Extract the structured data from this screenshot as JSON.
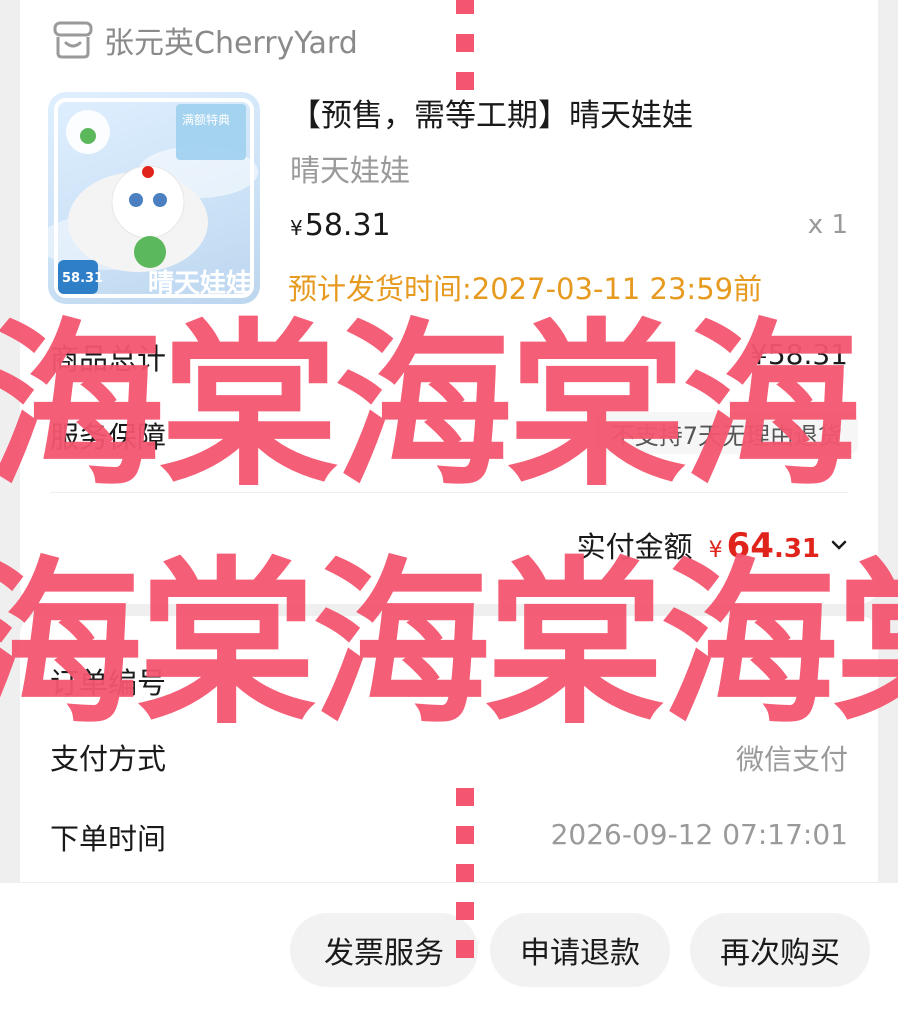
{
  "shop": {
    "name": "张元英CherryYard",
    "icon": "shop-icon"
  },
  "product": {
    "title": "【预售，需等工期】晴天娃娃",
    "subtitle": "晴天娃娃",
    "price_symbol": "¥",
    "price": "58.31",
    "quantity": "x 1",
    "ship_note": "预计发货时间:2027-03-11 23:59前",
    "image_text": {
      "badge_price": "58.31",
      "caption": "晴天娃娃",
      "corner": "满额特典"
    }
  },
  "summary": {
    "total_label": "商品总计",
    "total_value": "¥58.31",
    "guarantee_label": "服务保障",
    "guarantee_value": "不支持7天无理由退货",
    "paid_label": "实付金额",
    "paid_symbol": "¥",
    "paid_int": "64",
    "paid_dec": ".31"
  },
  "order_info": {
    "order_no_label": "订单编号",
    "pay_method_label": "支付方式",
    "pay_method_value": "微信支付",
    "order_time_label": "下单时间",
    "order_time_value": "2026-09-12 07:17:01"
  },
  "actions": {
    "invoice": "发票服务",
    "refund": "申请退款",
    "rebuy": "再次购买"
  },
  "watermark": {
    "line1": "海棠海棠海",
    "line2": "海棠海棠海棠"
  },
  "colors": {
    "accent_red": "#e0241b",
    "ship_orange": "#e69a1f",
    "watermark_pink": "#f4566f"
  }
}
